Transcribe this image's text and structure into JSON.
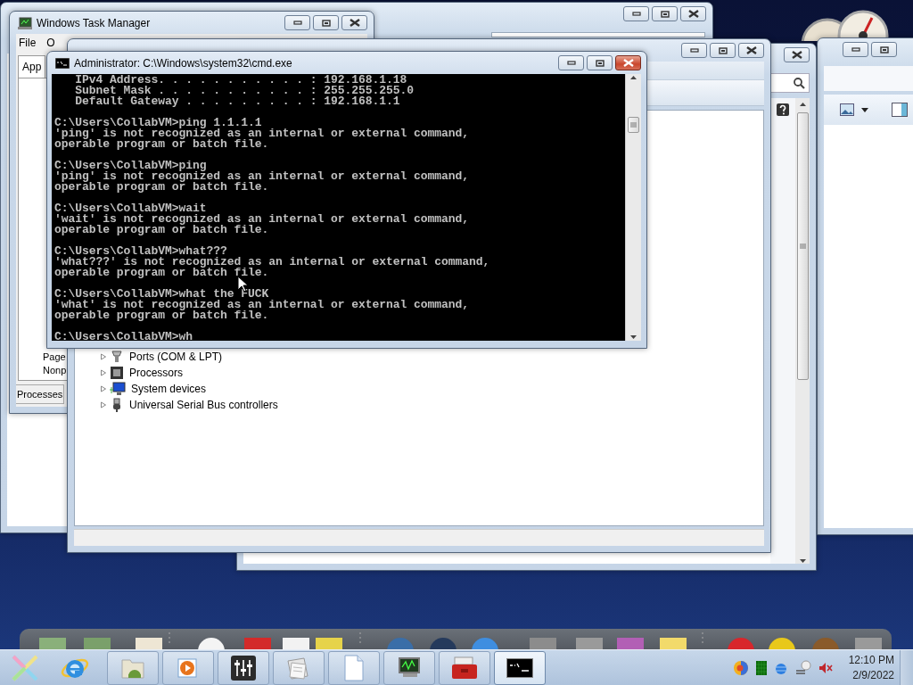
{
  "task_manager": {
    "title": "Windows Task Manager",
    "focused": false,
    "menu": [
      "File",
      "O"
    ],
    "tab": "App",
    "labels": [
      "Page",
      "Nonp"
    ],
    "bottom_tab": "Processes"
  },
  "device_manager": {
    "focused": false,
    "items": [
      {
        "label": "Ports (COM & LPT)",
        "kind": "port",
        "expanded": false
      },
      {
        "label": "Processors",
        "kind": "cpu",
        "expanded": false
      },
      {
        "label": "System devices",
        "kind": "system",
        "expanded": false
      },
      {
        "label": "Universal Serial Bus controllers",
        "kind": "usb",
        "expanded": false
      }
    ]
  },
  "console": {
    "title": "Administrator: C:\\Windows\\system32\\cmd.exe",
    "focused": true,
    "blocks": [
      [
        "   IPv4 Address. . . . . . . . . . . : 192.168.1.18",
        "   Subnet Mask . . . . . . . . . . . : 255.255.255.0",
        "   Default Gateway . . . . . . . . . : 192.168.1.1"
      ],
      [
        "C:\\Users\\CollabVM>ping 1.1.1.1",
        "'ping' is not recognized as an internal or external command,",
        "operable program or batch file."
      ],
      [
        "C:\\Users\\CollabVM>ping",
        "'ping' is not recognized as an internal or external command,",
        "operable program or batch file."
      ],
      [
        "C:\\Users\\CollabVM>wait",
        "'wait' is not recognized as an internal or external command,",
        "operable program or batch file."
      ],
      [
        "C:\\Users\\CollabVM>what???",
        "'what???' is not recognized as an internal or external command,",
        "operable program or batch file."
      ],
      [
        "C:\\Users\\CollabVM>what the FUCK",
        "'what' is not recognized as an internal or external command,",
        "operable program or batch file."
      ],
      [
        "C:\\Users\\CollabVM>wh"
      ]
    ]
  },
  "taskbar": {
    "buttons": [
      {
        "kind": "android-folder",
        "selected": false
      },
      {
        "kind": "media",
        "selected": false
      },
      {
        "kind": "mixer",
        "selected": false
      },
      {
        "kind": "notes",
        "selected": false
      },
      {
        "kind": "document",
        "selected": false
      },
      {
        "kind": "monitor",
        "selected": false
      },
      {
        "kind": "toolbox",
        "selected": false
      },
      {
        "kind": "console",
        "selected": true
      }
    ],
    "clock": {
      "time": "12:10 PM",
      "date": "2/9/2022"
    }
  }
}
